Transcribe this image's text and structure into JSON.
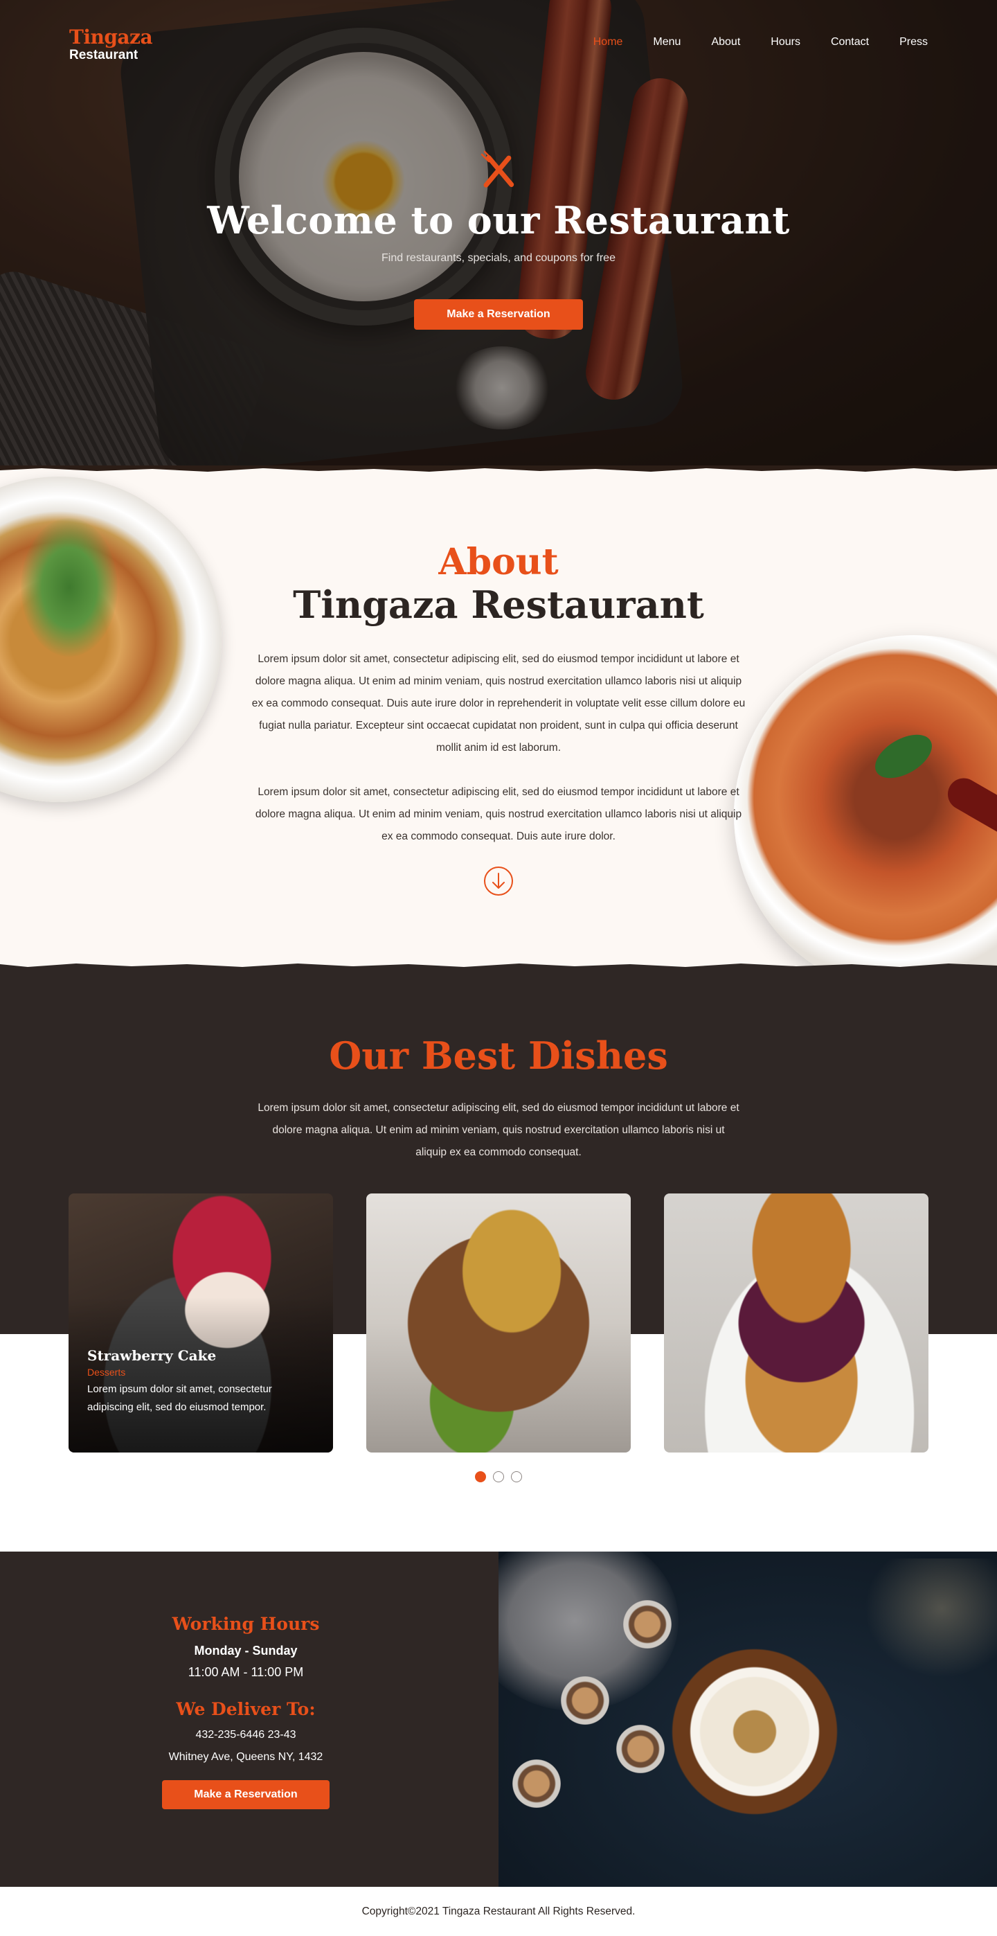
{
  "brand": {
    "name_top": "Tingaza",
    "name_bottom": "Restaurant"
  },
  "nav": {
    "items": [
      {
        "label": "Home",
        "active": true
      },
      {
        "label": "Menu",
        "active": false
      },
      {
        "label": "About",
        "active": false
      },
      {
        "label": "Hours",
        "active": false
      },
      {
        "label": "Contact",
        "active": false
      },
      {
        "label": "Press",
        "active": false
      }
    ]
  },
  "hero": {
    "icon": "fork-knife-icon",
    "title": "Welcome to our Restaurant",
    "subtitle": "Find restaurants, specials, and coupons for free",
    "cta": "Make a Reservation"
  },
  "about": {
    "kicker": "About",
    "title": "Tingaza Restaurant",
    "paragraph1": "Lorem ipsum dolor sit amet, consectetur adipiscing elit, sed do eiusmod tempor incididunt ut labore et dolore magna aliqua. Ut enim ad minim veniam, quis nostrud exercitation ullamco laboris nisi ut aliquip ex ea commodo consequat. Duis aute irure dolor in reprehenderit in voluptate velit esse cillum dolore eu fugiat nulla pariatur. Excepteur sint occaecat cupidatat non proident, sunt in culpa qui officia deserunt mollit anim id est laborum.",
    "paragraph2": "Lorem ipsum dolor sit amet, consectetur adipiscing elit, sed do eiusmod tempor incididunt ut labore et dolore magna aliqua. Ut enim ad minim veniam, quis nostrud exercitation ullamco laboris nisi ut aliquip ex ea commodo consequat. Duis aute irure dolor.",
    "scroll_icon": "arrow-down-circle-icon"
  },
  "dishes": {
    "title": "Our Best Dishes",
    "text": "Lorem ipsum dolor sit amet, consectetur adipiscing elit, sed do eiusmod tempor incididunt ut labore et dolore magna aliqua. Ut enim ad minim veniam, quis nostrud exercitation ullamco laboris nisi ut aliquip ex ea commodo consequat.",
    "cards": [
      {
        "name": "Strawberry Cake",
        "category": "Desserts",
        "description": "Lorem ipsum dolor sit amet, consectetur adipiscing elit, sed do eiusmod tempor."
      },
      {
        "name": "",
        "category": "",
        "description": ""
      },
      {
        "name": "",
        "category": "",
        "description": ""
      }
    ],
    "carousel": {
      "count": 3,
      "active": 0
    }
  },
  "hours": {
    "title": "Working Hours",
    "days": "Monday - Sunday",
    "time": "11:00 AM - 11:00 PM",
    "deliver_title": "We Deliver To:",
    "phone": "432-235-6446 23-43",
    "address": "Whitney Ave, Queens NY, 1432",
    "cta": "Make a Reservation"
  },
  "footer": {
    "copyright": "Copyright©2021 Tingaza Restaurant All Rights Reserved."
  },
  "colors": {
    "accent": "#e8501a",
    "dark": "#2f2725",
    "cream": "#fdf8f4"
  }
}
